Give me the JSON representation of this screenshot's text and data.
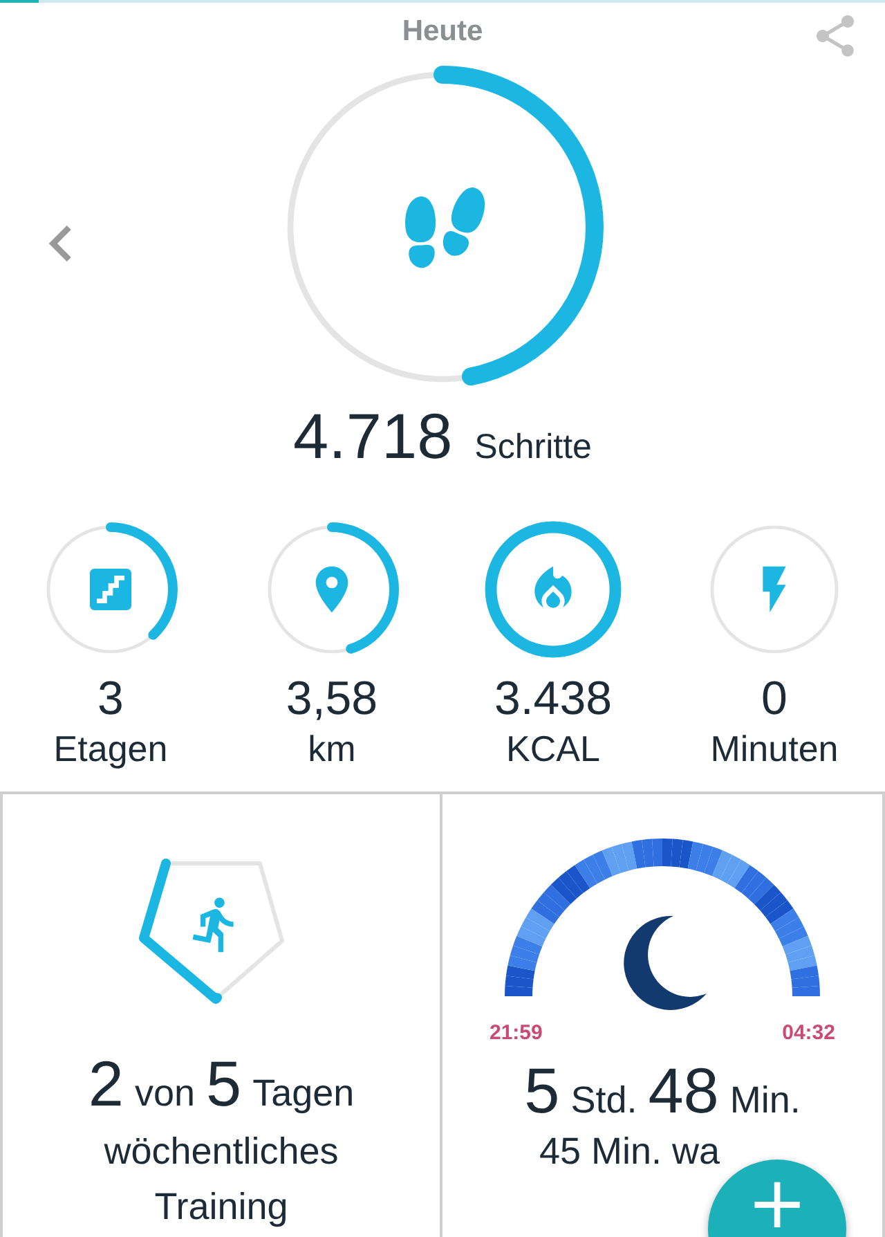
{
  "header": {
    "title": "Heute"
  },
  "steps": {
    "value": "4.718",
    "unit": "Schritte"
  },
  "stats": [
    {
      "kind": "floors",
      "value": "3",
      "label": "Etagen"
    },
    {
      "kind": "distance",
      "value": "3,58",
      "label": "km"
    },
    {
      "kind": "calories",
      "value": "3.438",
      "label": "KCAL"
    },
    {
      "kind": "active",
      "value": "0",
      "label": "Minuten"
    }
  ],
  "exercise": {
    "done": "2",
    "of": "von",
    "target": "5",
    "unit": "Tagen",
    "label": "wöchentliches Training"
  },
  "sleep": {
    "start": "21:59",
    "end": "04:32",
    "hours": "5",
    "hours_unit": "Std.",
    "minutes": "48",
    "minutes_unit": "Min.",
    "awake": "45 Min. wa"
  },
  "fab": {
    "label": "+"
  }
}
